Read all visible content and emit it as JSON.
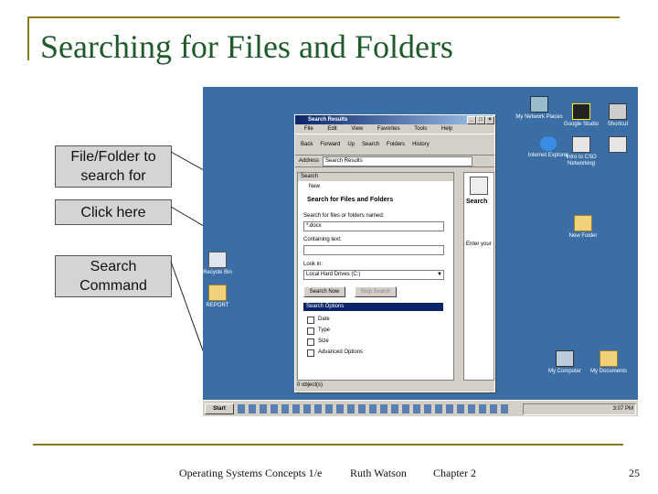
{
  "slide": {
    "title": "Searching for Files and Folders",
    "footer_text": "Operating Systems Concepts 1/e",
    "author": "Ruth Watson",
    "chapter": "Chapter 2",
    "page_number": "25"
  },
  "callouts": [
    {
      "label": "File/Folder to search for"
    },
    {
      "label": "Click here"
    },
    {
      "label": "Search Command"
    }
  ],
  "desktop": {
    "icons": {
      "my_network": "My Network Places",
      "google_studio": "Google Studio",
      "shortcut": "Shortcut",
      "internet_explorer": "Internet Explorer",
      "intro_networking": "Intro to CSO Networking",
      "new_folder": "New Folder",
      "recycle_bin": "Recycle Bin",
      "report": "REPORT",
      "my_computer": "My Computer",
      "my_documents": "My Documents"
    }
  },
  "window": {
    "title": "Search Results",
    "menu": [
      "File",
      "Edit",
      "View",
      "Favorites",
      "Tools",
      "Help"
    ],
    "toolbar": [
      "Back",
      "Forward",
      "Up",
      "Search",
      "Folders",
      "History"
    ],
    "address_label": "Address",
    "address_value": "Search Results",
    "search_pane": {
      "header": "Search",
      "new_label": "New",
      "heading": "Search for Files and Folders",
      "named_label": "Search for files or folders named:",
      "named_value": "*.docx",
      "containing_label": "Containing text:",
      "containing_value": "",
      "lookin_label": "Look in:",
      "lookin_value": "Local Hard Drives (C:)",
      "search_now": "Search Now",
      "stop_search": "Stop Search",
      "options_header": "Search Options",
      "options": [
        "Date",
        "Type",
        "Size",
        "Advanced Options"
      ]
    },
    "results_pane": {
      "label": "Search",
      "enter_label": "Enter your"
    },
    "status": "0 object(s)"
  },
  "taskbar": {
    "start_label": "Start",
    "clock": "3:07 PM"
  },
  "colors": {
    "title": "#1f5a2a",
    "rule": "#8a7a1a",
    "desktop": "#3a6ea5",
    "window_face": "#d4d0c8"
  }
}
